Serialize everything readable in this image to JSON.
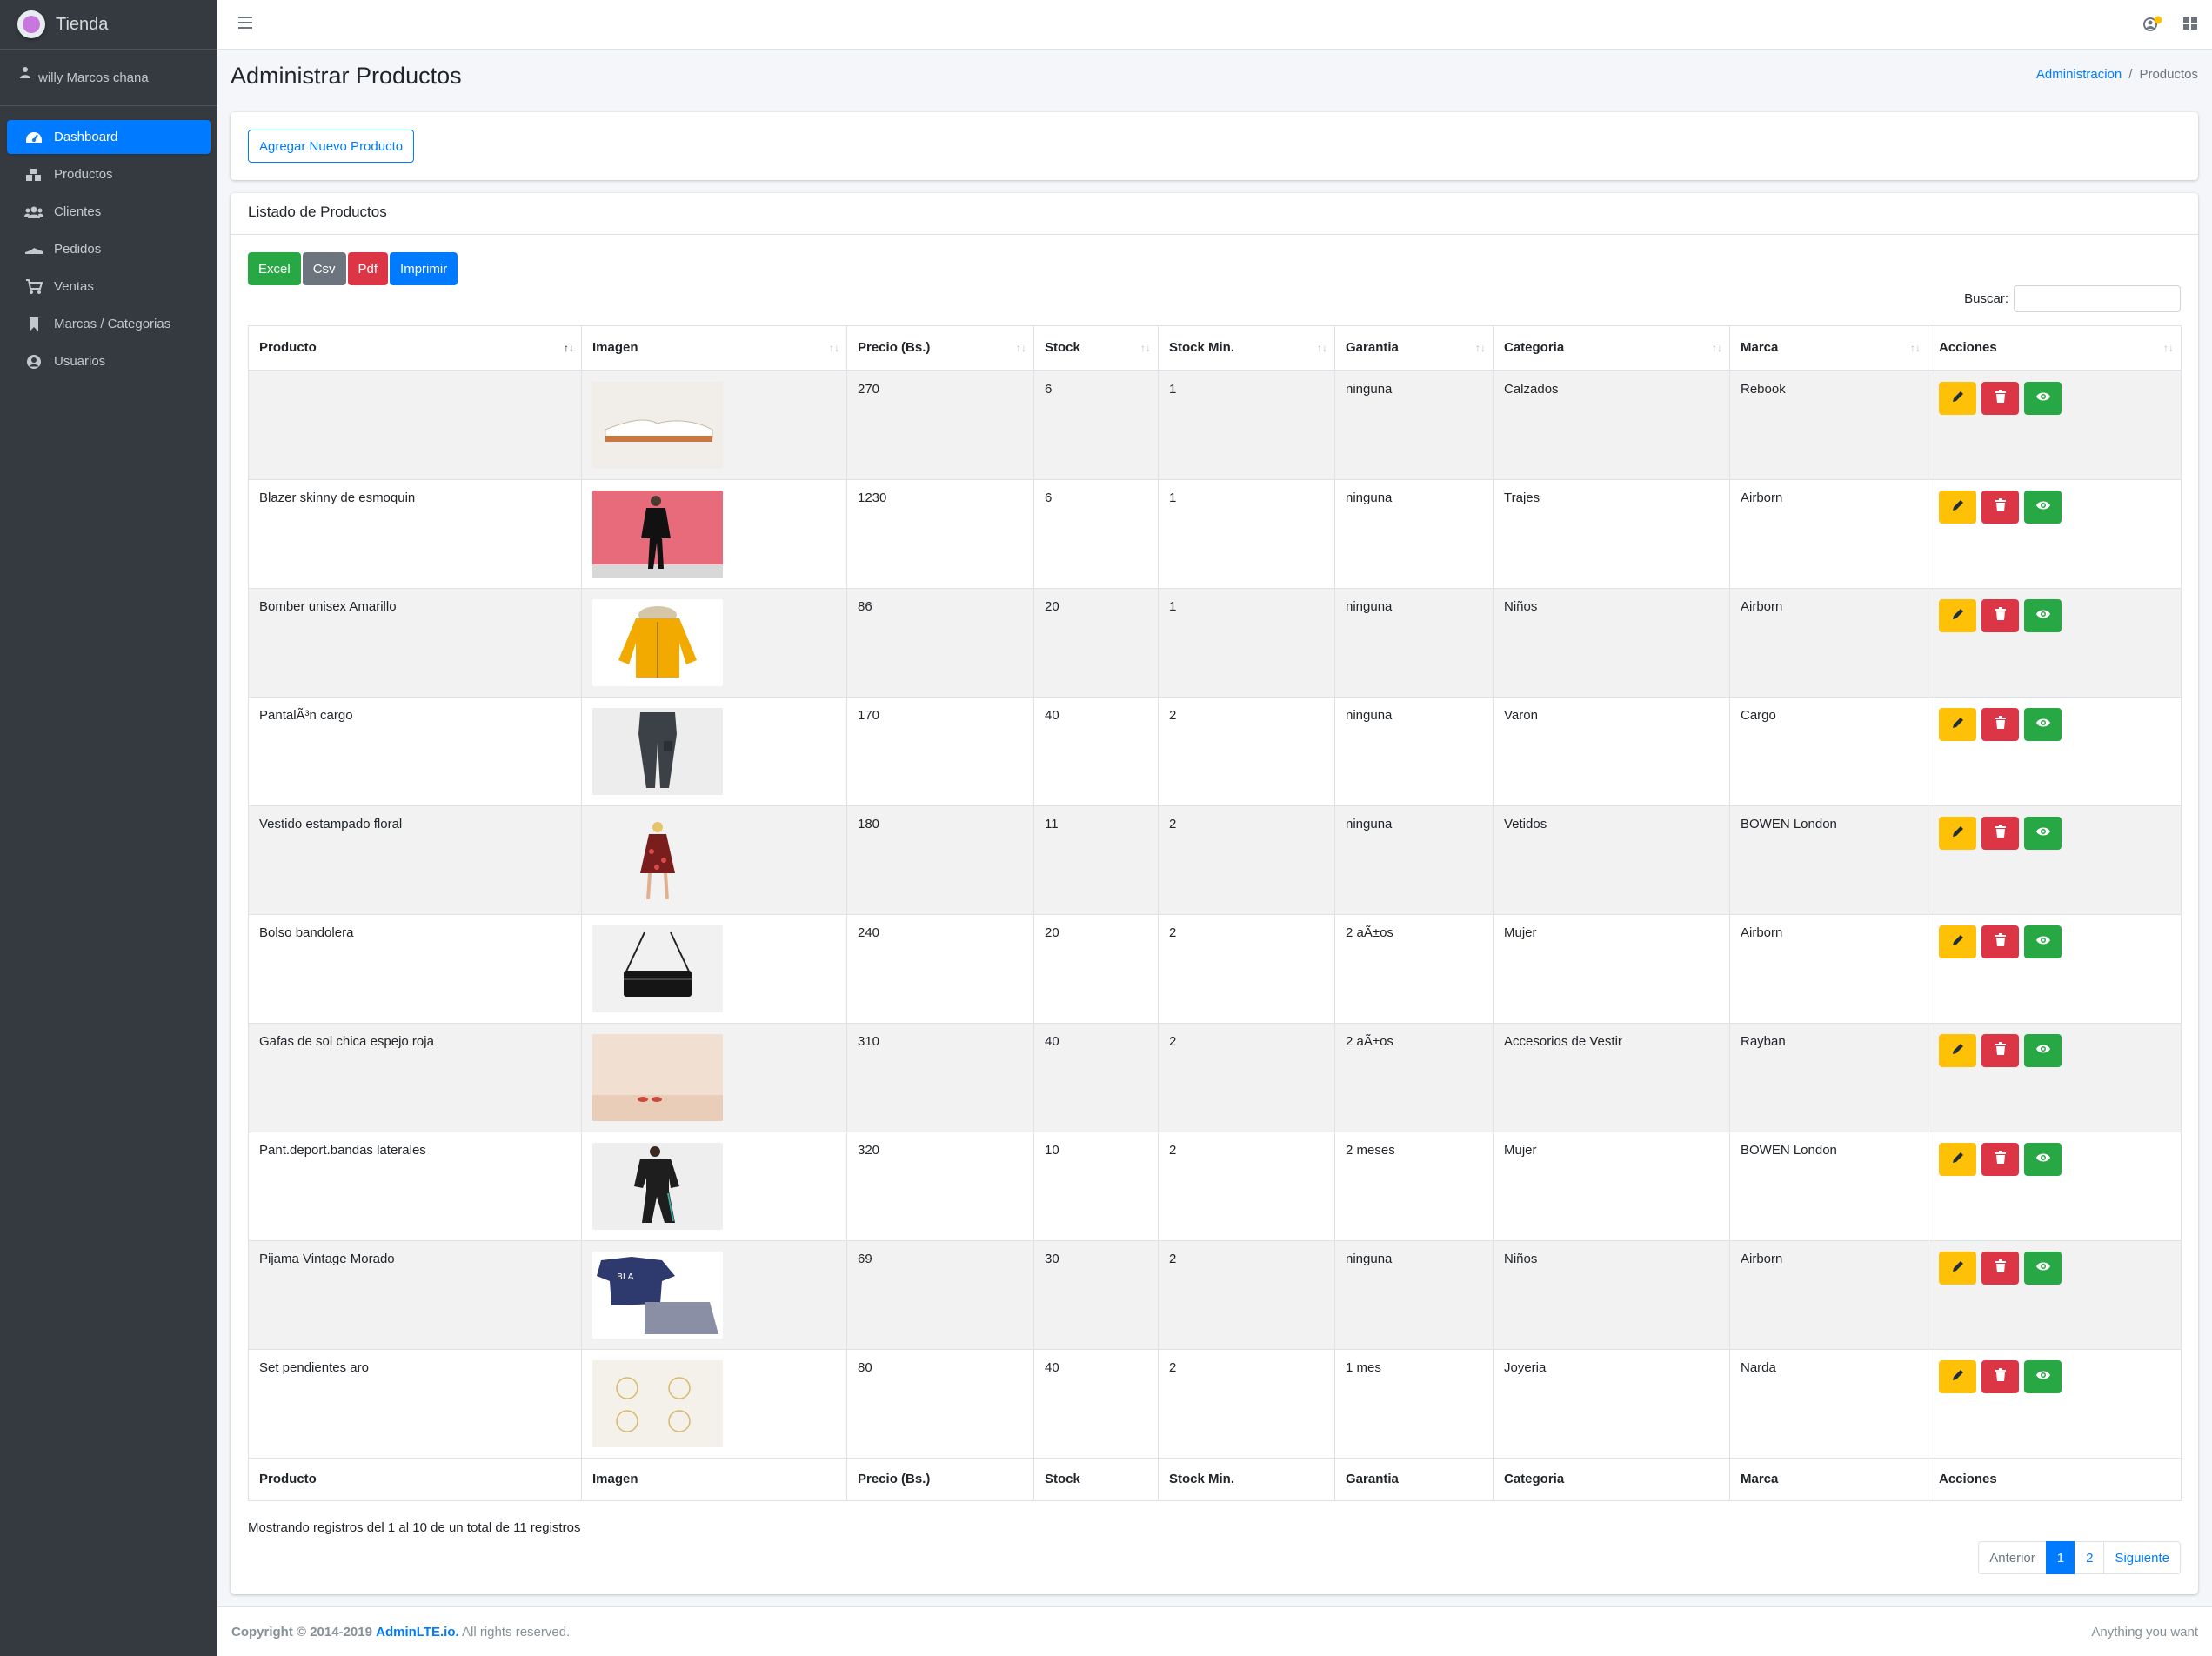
{
  "brand": {
    "name": "Tienda"
  },
  "user": {
    "name": "willy Marcos chana"
  },
  "sidebar": {
    "items": [
      {
        "label": "Dashboard",
        "icon": "dashboard-icon",
        "active": true
      },
      {
        "label": "Productos",
        "icon": "cubes-icon"
      },
      {
        "label": "Clientes",
        "icon": "users-icon"
      },
      {
        "label": "Pedidos",
        "icon": "shoe-icon"
      },
      {
        "label": "Ventas",
        "icon": "cart-icon"
      },
      {
        "label": "Marcas / Categorias",
        "icon": "bookmark-icon"
      },
      {
        "label": "Usuarios",
        "icon": "user-circle-icon"
      }
    ]
  },
  "header": {
    "title": "Administrar Productos",
    "breadcrumb": {
      "home": "Administracion",
      "separator": "/",
      "current": "Productos"
    }
  },
  "toolbar": {
    "add_label": "Agregar Nuevo Producto"
  },
  "listing": {
    "title": "Listado de Productos",
    "export_buttons": [
      {
        "label": "Excel",
        "color": "#28a745"
      },
      {
        "label": "Csv",
        "color": "#6c757d"
      },
      {
        "label": "Pdf",
        "color": "#dc3545"
      },
      {
        "label": "Imprimir",
        "color": "#007bff"
      }
    ],
    "search_label": "Buscar:",
    "search_value": ""
  },
  "table": {
    "columns": [
      "Producto",
      "Imagen",
      "Precio (Bs.)",
      "Stock",
      "Stock Min.",
      "Garantia",
      "Categoria",
      "Marca",
      "Acciones"
    ],
    "rows": [
      {
        "producto": "",
        "image": "sneakers",
        "precio": "270",
        "stock": "6",
        "stock_min": "1",
        "garantia": "ninguna",
        "categoria": "Calzados",
        "marca": "Rebook"
      },
      {
        "producto": "Blazer skinny de esmoquin",
        "image": "blazer",
        "precio": "1230",
        "stock": "6",
        "stock_min": "1",
        "garantia": "ninguna",
        "categoria": "Trajes",
        "marca": "Airborn"
      },
      {
        "producto": "Bomber unisex Amarillo",
        "image": "yellow-jacket",
        "precio": "86",
        "stock": "20",
        "stock_min": "1",
        "garantia": "ninguna",
        "categoria": "Niños",
        "marca": "Airborn"
      },
      {
        "producto": "PantalÃ³n cargo",
        "image": "cargo-pants",
        "precio": "170",
        "stock": "40",
        "stock_min": "2",
        "garantia": "ninguna",
        "categoria": "Varon",
        "marca": "Cargo"
      },
      {
        "producto": "Vestido estampado floral",
        "image": "floral-dress",
        "precio": "180",
        "stock": "11",
        "stock_min": "2",
        "garantia": "ninguna",
        "categoria": "Vetidos",
        "marca": "BOWEN London"
      },
      {
        "producto": "Bolso bandolera",
        "image": "bag",
        "precio": "240",
        "stock": "20",
        "stock_min": "2",
        "garantia": "2 aÃ±os",
        "categoria": "Mujer",
        "marca": "Airborn"
      },
      {
        "producto": "Gafas de sol chica espejo roja",
        "image": "sunglasses",
        "precio": "310",
        "stock": "40",
        "stock_min": "2",
        "garantia": "2 aÃ±os",
        "categoria": "Accesorios de Vestir",
        "marca": "Rayban"
      },
      {
        "producto": "Pant.deport.bandas laterales",
        "image": "tracksuit",
        "precio": "320",
        "stock": "10",
        "stock_min": "2",
        "garantia": "2 meses",
        "categoria": "Mujer",
        "marca": "BOWEN London"
      },
      {
        "producto": "Pijama Vintage Morado",
        "image": "pajama",
        "precio": "69",
        "stock": "30",
        "stock_min": "2",
        "garantia": "ninguna",
        "categoria": "Niños",
        "marca": "Airborn"
      },
      {
        "producto": "Set pendientes aro",
        "image": "earrings",
        "precio": "80",
        "stock": "40",
        "stock_min": "2",
        "garantia": "1 mes",
        "categoria": "Joyeria",
        "marca": "Narda"
      }
    ]
  },
  "table_info": "Mostrando registros del 1 al 10 de un total de 11 registros",
  "pagination": {
    "prev": "Anterior",
    "pages": [
      "1",
      "2"
    ],
    "current": "1",
    "next": "Siguiente"
  },
  "footer": {
    "copyright_prefix": "Copyright © 2014-2019",
    "copyright_brand": "AdminLTE.io.",
    "copyright_suffix": "All rights reserved.",
    "right_text": "Anything you want"
  },
  "colors": {
    "primary": "#007bff",
    "sidebar_bg": "#343a40",
    "warning": "#ffc107",
    "danger": "#dc3545",
    "success": "#28a745"
  }
}
